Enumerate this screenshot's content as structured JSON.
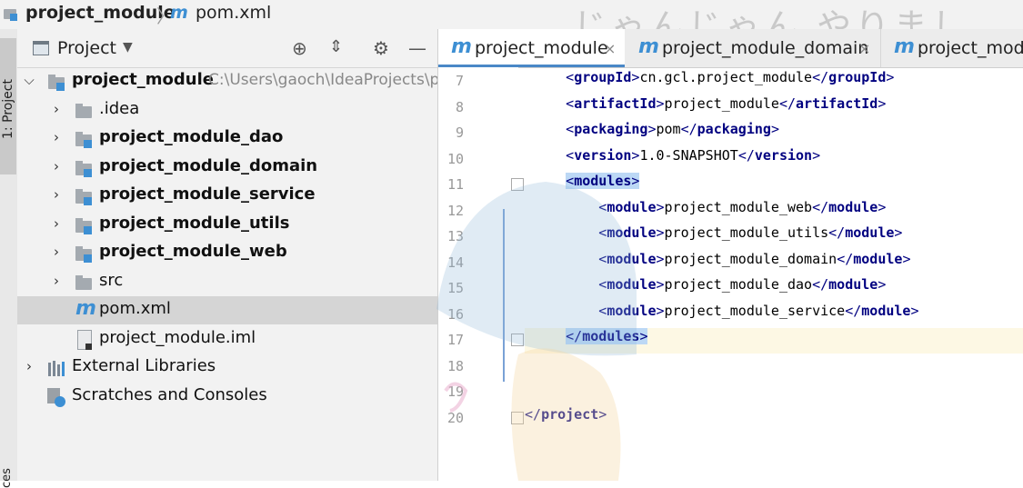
{
  "breadcrumb": {
    "root": "project_module",
    "separator": "〉",
    "file_icon": "m",
    "file": "pom.xml"
  },
  "watermark": "じゃんじゃん やりまし",
  "left_strip": {
    "label": "1: Project",
    "bottom_label": "ces"
  },
  "project_panel": {
    "title": "Project",
    "tree": [
      {
        "label": "project_module",
        "path": "C:\\Users\\gaoch\\IdeaProjects\\p",
        "bold": true,
        "icon": "module-folder-icon",
        "expanded": true
      },
      {
        "label": ".idea",
        "icon": "folder-icon"
      },
      {
        "label": "project_module_dao",
        "bold": true,
        "icon": "module-folder-icon"
      },
      {
        "label": "project_module_domain",
        "bold": true,
        "icon": "module-folder-icon"
      },
      {
        "label": "project_module_service",
        "bold": true,
        "icon": "module-folder-icon"
      },
      {
        "label": "project_module_utils",
        "bold": true,
        "icon": "module-folder-icon"
      },
      {
        "label": "project_module_web",
        "bold": true,
        "icon": "module-folder-icon"
      },
      {
        "label": "src",
        "icon": "folder-icon"
      },
      {
        "label": "pom.xml",
        "icon": "maven-icon",
        "selected": true
      },
      {
        "label": "project_module.iml",
        "icon": "iml-file-icon"
      },
      {
        "label": "External Libraries",
        "icon": "library-icon"
      },
      {
        "label": "Scratches and Consoles",
        "icon": "scratches-icon"
      }
    ]
  },
  "tabs": [
    {
      "icon": "m",
      "label": "project_module",
      "close": "×",
      "active": true
    },
    {
      "icon": "m",
      "label": "project_module_domain",
      "close": "×"
    },
    {
      "icon": "m",
      "label": "project_modu"
    }
  ],
  "editor": {
    "line_numbers": [
      "7",
      "8",
      "9",
      "10",
      "11",
      "12",
      "13",
      "14",
      "15",
      "16",
      "17",
      "18",
      "19",
      "20"
    ],
    "lines": [
      {
        "tag": "groupId",
        "value": "cn.gcl.project_module"
      },
      {
        "tag": "artifactId",
        "value": "project_module"
      },
      {
        "tag": "packaging",
        "value": "pom"
      },
      {
        "tag": "version",
        "value": "1.0-SNAPSHOT"
      },
      {
        "open": "modules"
      },
      {
        "tag": "module",
        "value": "project_module_web"
      },
      {
        "tag": "module",
        "value": "project_module_utils"
      },
      {
        "tag": "module",
        "value": "project_module_domain"
      },
      {
        "tag": "module",
        "value": "project_module_dao"
      },
      {
        "tag": "module",
        "value": "project_module_service"
      },
      {
        "close": "modules"
      },
      {},
      {},
      {
        "close": "project"
      }
    ]
  },
  "colors": {
    "accent": "#3d8fd3",
    "tag": "#000080",
    "highlight": "#bcd8f5",
    "current_line": "#fdf8e4"
  }
}
